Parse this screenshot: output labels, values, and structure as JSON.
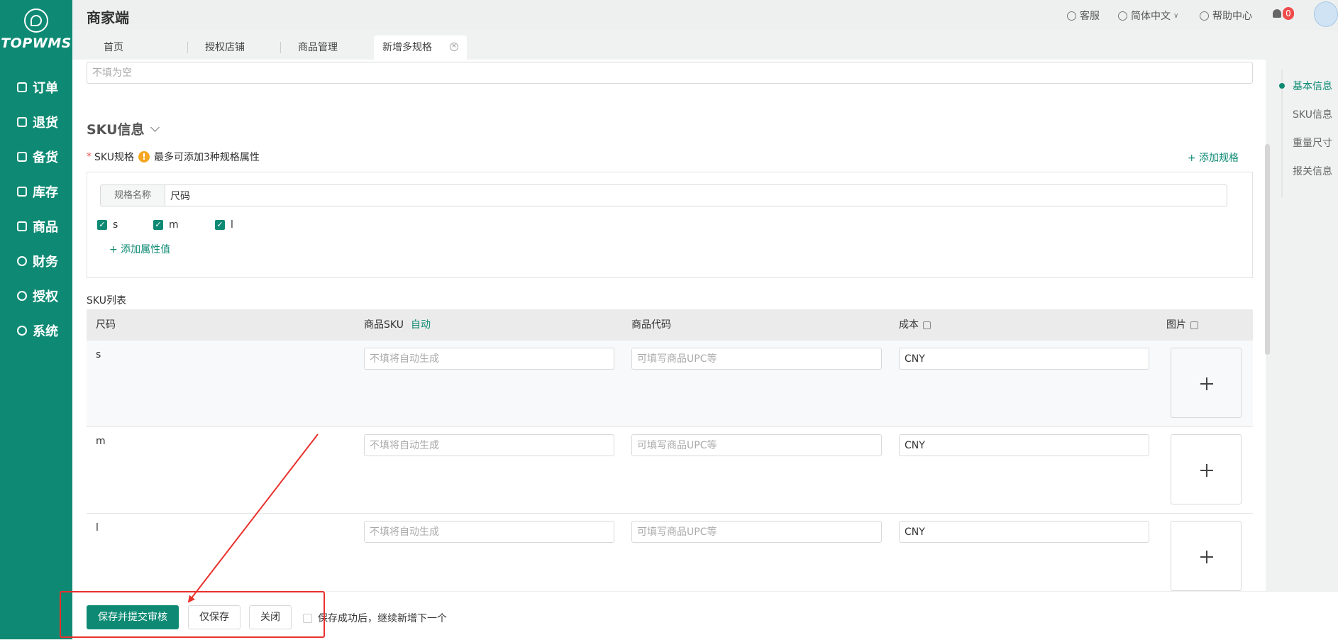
{
  "sidebar": {
    "logo_text": "TOPWMS",
    "items": [
      {
        "label": "订单",
        "icon": "order-icon"
      },
      {
        "label": "退货",
        "icon": "return-icon"
      },
      {
        "label": "备货",
        "icon": "stock-prep-icon"
      },
      {
        "label": "库存",
        "icon": "inventory-icon"
      },
      {
        "label": "商品",
        "icon": "product-icon"
      },
      {
        "label": "财务",
        "icon": "finance-icon"
      },
      {
        "label": "授权",
        "icon": "auth-icon"
      },
      {
        "label": "系统",
        "icon": "settings-icon"
      }
    ]
  },
  "header": {
    "title": "商家端",
    "customer_service": "客服",
    "language": "简体中文",
    "help_center": "帮助中心",
    "notification_count": "0"
  },
  "tabs": [
    {
      "label": "首页"
    },
    {
      "label": "授权店铺"
    },
    {
      "label": "商品管理"
    },
    {
      "label": "新增多规格",
      "active": true
    }
  ],
  "form": {
    "top_placeholder": "不填为空",
    "section_title": "SKU信息",
    "sku_spec_label": "SKU规格",
    "sku_spec_hint": "最多可添加3种规格属性",
    "add_spec_label": "+ 添加规格",
    "spec_name_label": "规格名称",
    "spec_name_value": "尺码",
    "attribute_values": [
      {
        "label": "s",
        "checked": true
      },
      {
        "label": "m",
        "checked": true
      },
      {
        "label": "l",
        "checked": true
      }
    ],
    "add_attr_label": "+ 添加属性值",
    "sku_list_label": "SKU列表",
    "columns": {
      "size": "尺码",
      "sku": "商品SKU",
      "sku_auto": "自动",
      "code": "商品代码",
      "cost": "成本",
      "image": "图片"
    },
    "rows": [
      {
        "size": "s",
        "sku_placeholder": "不填将自动生成",
        "code_placeholder": "可填写商品UPC等",
        "cost_value": "CNY"
      },
      {
        "size": "m",
        "sku_placeholder": "不填将自动生成",
        "code_placeholder": "可填写商品UPC等",
        "cost_value": "CNY"
      },
      {
        "size": "l",
        "sku_placeholder": "不填将自动生成",
        "code_placeholder": "可填写商品UPC等",
        "cost_value": "CNY"
      }
    ]
  },
  "anchors": [
    {
      "label": "基本信息",
      "active": true
    },
    {
      "label": "SKU信息"
    },
    {
      "label": "重量尺寸"
    },
    {
      "label": "报关信息"
    }
  ],
  "actions": {
    "submit_label": "保存并提交审核",
    "save_only_label": "仅保存",
    "close_label": "关闭",
    "continue_label": "保存成功后，继续新增下一个"
  },
  "colors": {
    "brand": "#0e8a74",
    "annotation": "#e8312c",
    "badge": "#f04b4b"
  }
}
